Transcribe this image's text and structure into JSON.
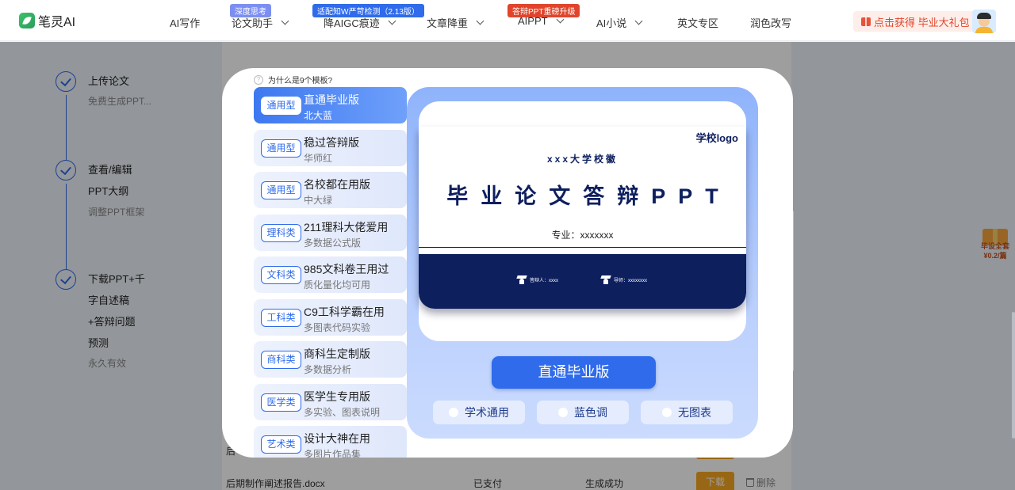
{
  "nav": {
    "brand": "笔灵AI",
    "items": [
      {
        "label": "AI写作"
      },
      {
        "label": "论文助手",
        "badge": "深度思考"
      },
      {
        "label": "降AIGC痕迹",
        "badge": "适配知W严苛检测（2.13版）"
      },
      {
        "label": "文章降重"
      },
      {
        "label": "AIPPT",
        "badge": "答辩PPT重磅升级"
      },
      {
        "label": "AI小说"
      },
      {
        "label": "英文专区"
      },
      {
        "label": "润色改写"
      }
    ],
    "gift_label": "点击获得 毕业大礼包",
    "colors": {
      "badge_purple": "#7c8ff0",
      "badge_blue": "#2f6bea",
      "badge_red": "#e0452c"
    }
  },
  "steps": [
    {
      "title": "上传论文",
      "sub": "免费生成PPT..."
    },
    {
      "title_lines": [
        "查看/编辑",
        "PPT大纲"
      ],
      "sub": "调整PPT框架"
    },
    {
      "title_lines": [
        "下载PPT+千",
        "字自述稿",
        "+答辩问题",
        "预测"
      ],
      "sub": "永久有效"
    }
  ],
  "background_rows": [
    {
      "name": "后",
      "status": "",
      "result": "",
      "action": ""
    },
    {
      "name": "后期制作阐述报告.docx",
      "status": "已支付",
      "result": "生成成功",
      "action": "下载",
      "delete": "删除"
    }
  ],
  "float_gift": {
    "line1": "毕设全套",
    "line2": "¥0.2/篇"
  },
  "modal": {
    "question": "为什么是9个模板?",
    "templates": [
      {
        "tag": "通用型",
        "name": "直通毕业版",
        "sub": "北大蓝",
        "active": true
      },
      {
        "tag": "通用型",
        "name": "稳过答辩版",
        "sub": "华师红"
      },
      {
        "tag": "通用型",
        "name": "名校都在用版",
        "sub": "中大绿"
      },
      {
        "tag": "理科类",
        "name": "211理科大佬爱用",
        "sub": "多数据公式版"
      },
      {
        "tag": "文科类",
        "name": "985文科卷王用过",
        "sub": "质化量化均可用"
      },
      {
        "tag": "工科类",
        "name": "C9工科学霸在用",
        "sub": "多图表代码实验"
      },
      {
        "tag": "商科类",
        "name": "商科生定制版",
        "sub": "多数据分析"
      },
      {
        "tag": "医学类",
        "name": "医学生专用版",
        "sub": "多实验、图表说明"
      },
      {
        "tag": "艺术类",
        "name": "设计大神在用",
        "sub": "多图片作品集"
      }
    ],
    "preview": {
      "logo": "学校logo",
      "school": "xxx大学校徽",
      "title": "毕业论文答辩PPT",
      "major": "专业：xxxxxxx",
      "presenter": "答辩人：xxxx",
      "advisor": "导师：xxxxxxxx"
    },
    "main_button": "直通毕业版",
    "options": [
      "学术通用",
      "蓝色调",
      "无图表"
    ]
  }
}
